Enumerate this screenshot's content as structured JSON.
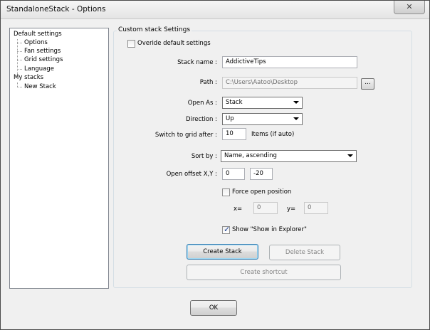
{
  "window": {
    "title": "StandaloneStack - Options",
    "close_symbol": "✕"
  },
  "tree": {
    "root1": "Default settings",
    "root1_children": [
      "Options",
      "Fan settings",
      "Grid settings",
      "Language"
    ],
    "root2": "My stacks",
    "root2_children": [
      "New Stack"
    ]
  },
  "group": {
    "label": "Custom stack Settings",
    "override_label": "Overide default  settings",
    "override_checked": false,
    "stack_name_label": "Stack name :",
    "stack_name_value": "AddictiveTips",
    "path_label": "Path :",
    "path_value": "C:\\Users\\Aatoo\\Desktop",
    "browse_label": "...",
    "open_as_label": "Open As :",
    "open_as_value": "Stack",
    "direction_label": "Direction :",
    "direction_value": "Up",
    "switch_grid_label": "Switch to grid after :",
    "switch_grid_value": "10",
    "switch_grid_suffix": "Items (if auto)",
    "sort_by_label": "Sort by :",
    "sort_by_value": "Name, ascending",
    "offset_label": "Open offset X,Y :",
    "offset_x": "0",
    "offset_y": "-20",
    "force_open_label": "Force open position",
    "force_open_checked": false,
    "x_label": "x=",
    "x_value": "0",
    "y_label": "y=",
    "y_value": "0",
    "show_explorer_label": "Show \"Show in Explorer\"",
    "show_explorer_checked": true,
    "create_stack": "Create Stack",
    "delete_stack": "Delete Stack",
    "create_shortcut": "Create shortcut"
  },
  "footer": {
    "ok": "OK"
  }
}
